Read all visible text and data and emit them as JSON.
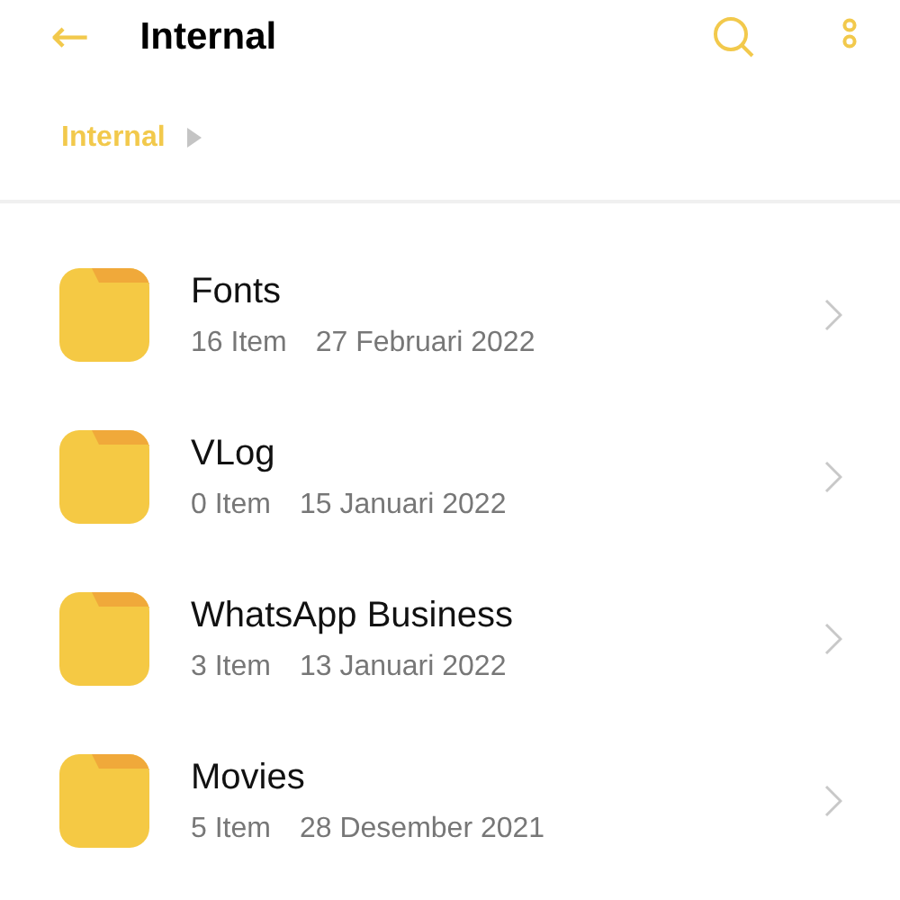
{
  "header": {
    "back_icon": "←",
    "title": "Internal"
  },
  "breadcrumb": [
    "Internal"
  ],
  "folders": [
    {
      "name": "Fonts",
      "count": "16 Item",
      "date": "27 Februari 2022"
    },
    {
      "name": "VLog",
      "count": "0 Item",
      "date": "15 Januari 2022"
    },
    {
      "name": "WhatsApp Business",
      "count": "3 Item",
      "date": "13 Januari 2022"
    },
    {
      "name": "Movies",
      "count": "5 Item",
      "date": "28 Desember 2021"
    }
  ]
}
